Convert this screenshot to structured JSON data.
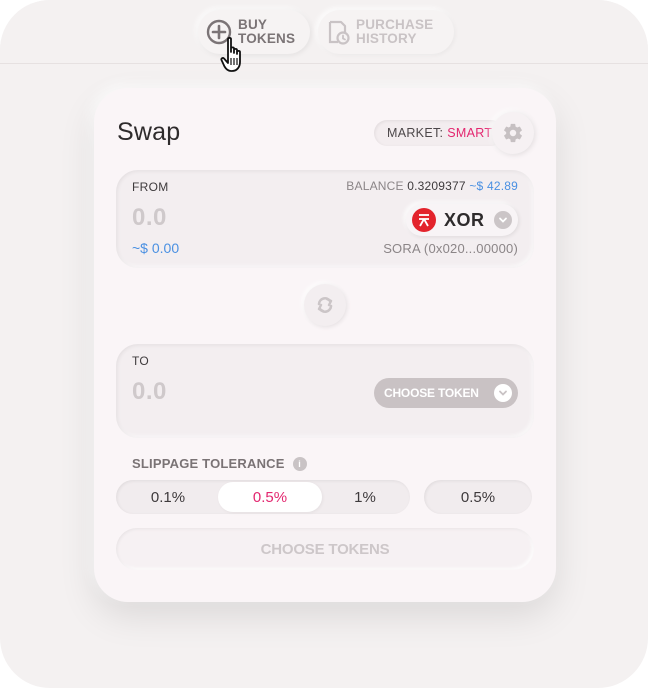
{
  "nav": {
    "buy_tokens": "BUY\nTOKENS",
    "purchase_history": "PURCHASE\nHISTORY"
  },
  "swap": {
    "title": "Swap",
    "market_label": "MARKET:",
    "market_value": "SMART",
    "from": {
      "label": "FROM",
      "balance_label": "BALANCE",
      "balance_value": "0.3209377",
      "balance_usd": "~$ 42.89",
      "amount": "0.0",
      "amount_usd": "~$ 0.00",
      "token_symbol": "XOR",
      "token_address": "SORA (0x020...00000)"
    },
    "to": {
      "label": "TO",
      "amount": "0.0",
      "choose_token_label": "CHOOSE TOKEN"
    },
    "slippage": {
      "label": "SLIPPAGE TOLERANCE",
      "options": [
        "0.1%",
        "0.5%",
        "1%"
      ],
      "selected_index": 1,
      "custom_value": "0.5%"
    },
    "submit_label": "CHOOSE TOKENS"
  },
  "colors": {
    "accent": "#e3266f",
    "usd": "#4a90e2",
    "xor_red": "#e3232c"
  },
  "icons": {
    "buy": "plus-circle-icon",
    "history": "receipt-clock-icon",
    "settings": "gear-icon",
    "swap": "swap-arrows-icon",
    "cursor": "hand-pointer-icon"
  }
}
